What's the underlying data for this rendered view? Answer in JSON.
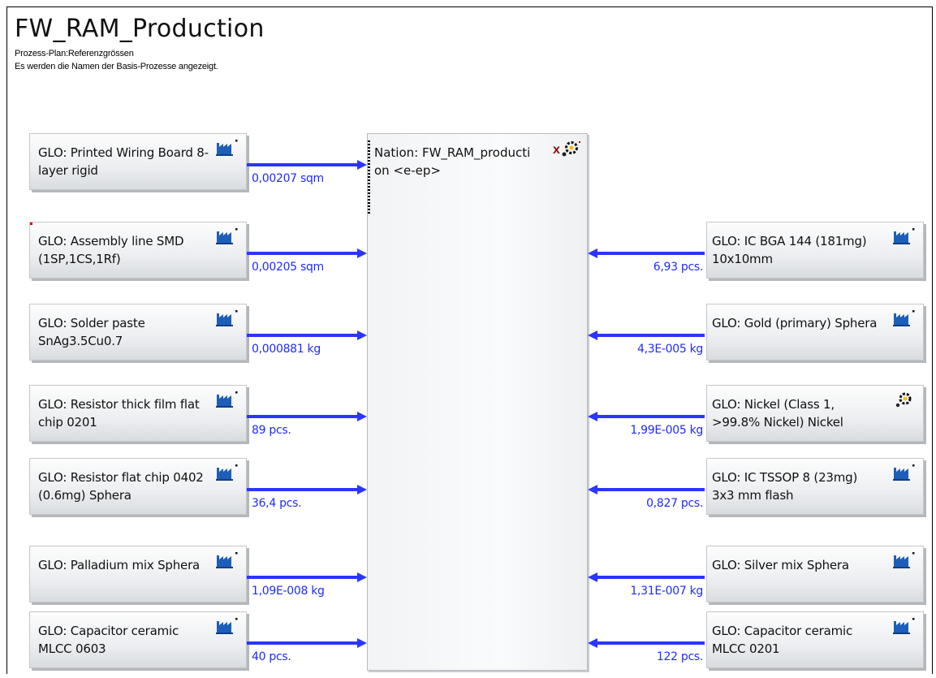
{
  "title": "FW_RAM_Production",
  "subtitle1": "Prozess-Plan:Referenzgrössen",
  "subtitle2": "Es werden die Namen der Basis-Prozesse angezeigt.",
  "central": {
    "label": "Nation: FW_RAM_production <e-ep>",
    "icon": "gear-x-icon"
  },
  "colors": {
    "flow": "#2b35ff",
    "amount": "#1f2aff",
    "factory": "#1d5fb8",
    "box_border": "#c4c7ca"
  },
  "left_processes": [
    {
      "label": "GLO: Printed Wiring Board 8-layer rigid",
      "amount": "0,00207 sqm",
      "icon": "factory-icon",
      "dot": false
    },
    {
      "label": "GLO: Assembly line SMD (1SP,1CS,1Rf)",
      "amount": "0,00205 sqm",
      "icon": "factory-icon",
      "dot": true
    },
    {
      "label": "GLO: Solder paste SnAg3.5Cu0.7",
      "amount": "0,000881 kg",
      "icon": "factory-icon",
      "dot": false
    },
    {
      "label": "GLO: Resistor thick film flat chip 0201",
      "amount": "89 pcs.",
      "icon": "factory-icon",
      "dot": false
    },
    {
      "label": "GLO: Resistor flat chip 0402 (0.6mg) Sphera",
      "amount": "36,4 pcs.",
      "icon": "factory-icon",
      "dot": false
    },
    {
      "label": "GLO: Palladium mix Sphera",
      "amount": "1,09E-008 kg",
      "icon": "factory-icon",
      "dot": false
    },
    {
      "label": "GLO: Capacitor ceramic MLCC 0603",
      "amount": "40 pcs.",
      "icon": "factory-icon",
      "dot": false
    }
  ],
  "right_processes": [
    {
      "label": "GLO: IC BGA 144 (181mg) 10x10mm",
      "amount": "6,93 pcs.",
      "icon": "factory-icon"
    },
    {
      "label": "GLO: Gold (primary) Sphera",
      "amount": "4,3E-005 kg",
      "icon": "factory-icon"
    },
    {
      "label": "GLO: Nickel (Class 1, >99.8% Nickel) Nickel",
      "amount": "1,99E-005 kg",
      "icon": "gear-icon"
    },
    {
      "label": "GLO: IC TSSOP 8 (23mg) 3x3 mm flash",
      "amount": "0,827 pcs.",
      "icon": "factory-icon"
    },
    {
      "label": "GLO: Silver mix Sphera",
      "amount": "1,31E-007 kg",
      "icon": "factory-icon"
    },
    {
      "label": "GLO: Capacitor ceramic MLCC 0201",
      "amount": "122 pcs.",
      "icon": "factory-icon"
    }
  ]
}
